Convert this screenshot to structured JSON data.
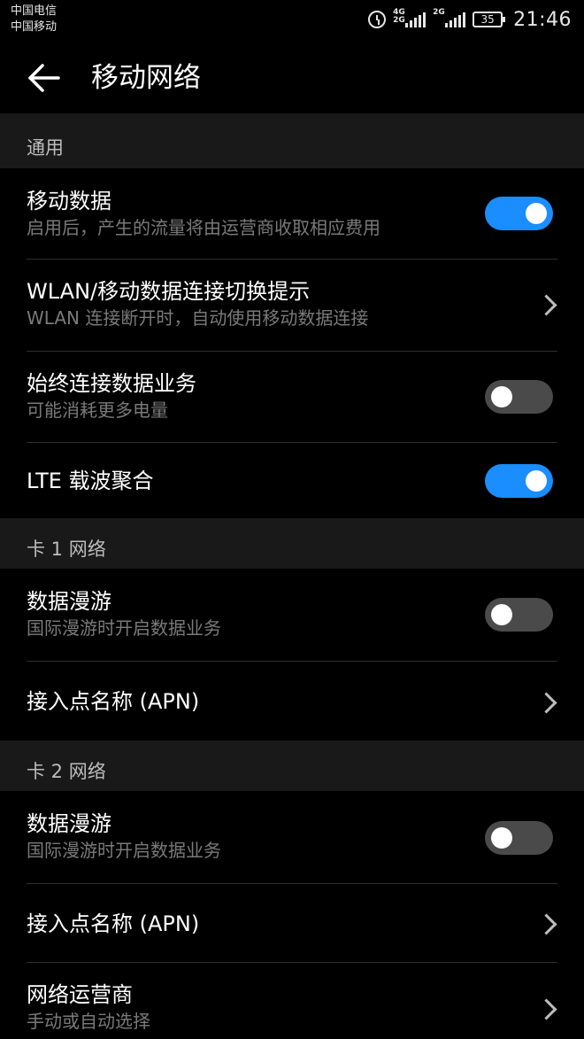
{
  "status_bar": {
    "carrier_1": "中国电信",
    "carrier_2": "中国移动",
    "sim1_network": "4G 2G",
    "sim2_network": "2G",
    "battery": "35",
    "time": "21:46"
  },
  "header": {
    "title": "移动网络",
    "back_icon": "arrow-left-icon"
  },
  "general": {
    "section_label": "通用",
    "mobile_data": {
      "title": "移动数据",
      "subtitle": "启用后，产生的流量将由运营商收取相应费用",
      "enabled": true
    },
    "wlan_switch": {
      "title": "WLAN/移动数据连接切换提示",
      "subtitle": "WLAN 连接断开时，自动使用移动数据连接"
    },
    "always_on": {
      "title": "始终连接数据业务",
      "subtitle": "可能消耗更多电量",
      "enabled": false
    },
    "lte_ca": {
      "title": "LTE 载波聚合",
      "enabled": true
    }
  },
  "sim1": {
    "section_label": "卡 1 网络",
    "roaming": {
      "title": "数据漫游",
      "subtitle": "国际漫游时开启数据业务",
      "enabled": false
    },
    "apn": {
      "title": "接入点名称 (APN)"
    }
  },
  "sim2": {
    "section_label": "卡 2 网络",
    "roaming": {
      "title": "数据漫游",
      "subtitle": "国际漫游时开启数据业务",
      "enabled": false
    },
    "apn": {
      "title": "接入点名称 (APN)"
    },
    "operator": {
      "title": "网络运营商",
      "subtitle": "手动或自动选择"
    }
  },
  "colors": {
    "accent": "#1a8dff",
    "background": "#000000",
    "section_background": "#191919",
    "secondary_text": "#7a7a7a"
  }
}
